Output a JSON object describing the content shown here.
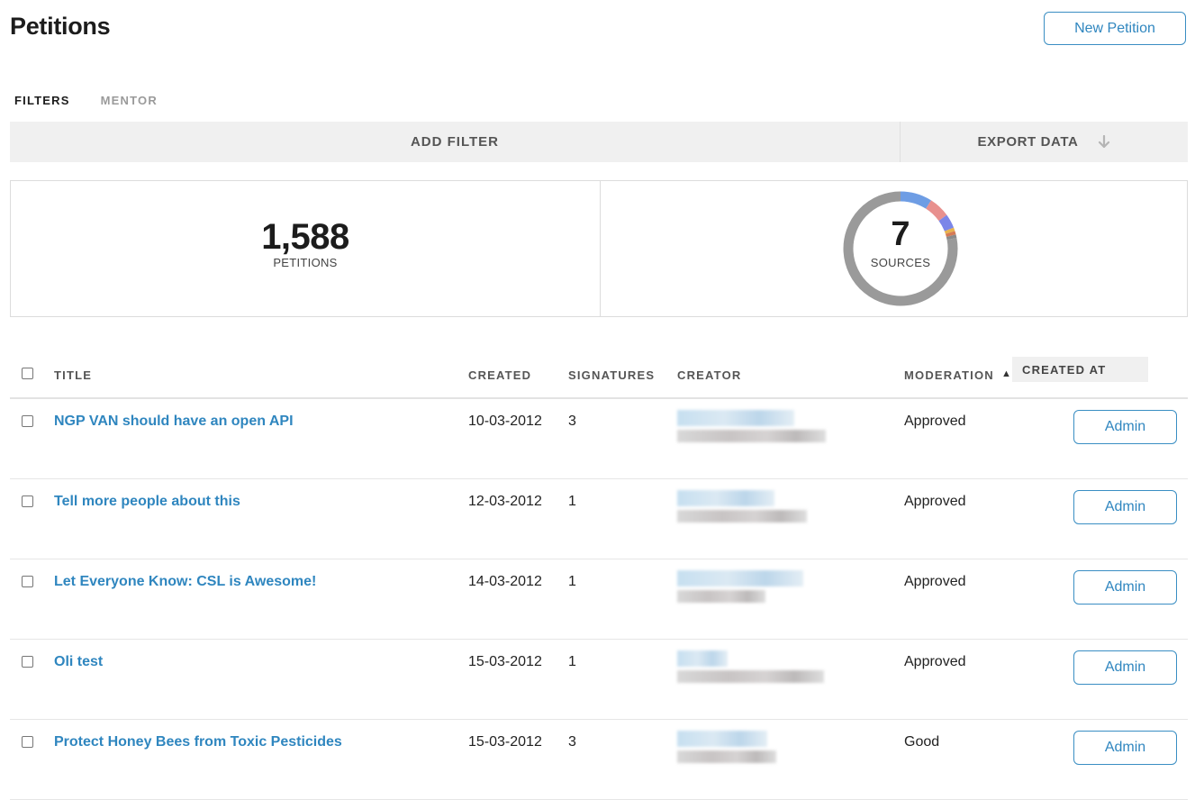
{
  "header": {
    "title": "Petitions",
    "new_button": "New Petition"
  },
  "tabs": [
    {
      "label": "FILTERS",
      "active": true
    },
    {
      "label": "MENTOR",
      "active": false
    }
  ],
  "filter_bar": {
    "add_filter": "ADD FILTER",
    "export": "EXPORT DATA",
    "export_icon": "arrow-down-icon"
  },
  "stats": {
    "petitions": {
      "value": "1,588",
      "label": "PETITIONS"
    },
    "sources": {
      "value": "7",
      "label": "SOURCES"
    },
    "source_colors": [
      "#6e9de4",
      "#e8908e",
      "#7b86e8",
      "#e7b34e",
      "#d67a55",
      "#8a8a8a",
      "#9a9a9a"
    ],
    "source_shares": [
      0.09,
      0.06,
      0.04,
      0.01,
      0.01,
      0.01,
      0.78
    ]
  },
  "table": {
    "columns": {
      "title": "TITLE",
      "created": "CREATED",
      "signatures": "SIGNATURES",
      "creator": "CREATOR",
      "moderation": "MODERATION",
      "created_at": "CREATED AT"
    },
    "sort_indicator": "▲",
    "rows": [
      {
        "title": "NGP VAN should have an open API",
        "created": "10-03-2012",
        "signatures": "3",
        "moderation": "Approved",
        "action": "Admin"
      },
      {
        "title": "Tell more people about this",
        "created": "12-03-2012",
        "signatures": "1",
        "moderation": "Approved",
        "action": "Admin"
      },
      {
        "title": "Let Everyone Know: CSL is Awesome!",
        "created": "14-03-2012",
        "signatures": "1",
        "moderation": "Approved",
        "action": "Admin"
      },
      {
        "title": "Oli test",
        "created": "15-03-2012",
        "signatures": "1",
        "moderation": "Approved",
        "action": "Admin"
      },
      {
        "title": "Protect Honey Bees from Toxic Pesticides",
        "created": "15-03-2012",
        "signatures": "3",
        "moderation": "Good",
        "action": "Admin"
      }
    ]
  }
}
